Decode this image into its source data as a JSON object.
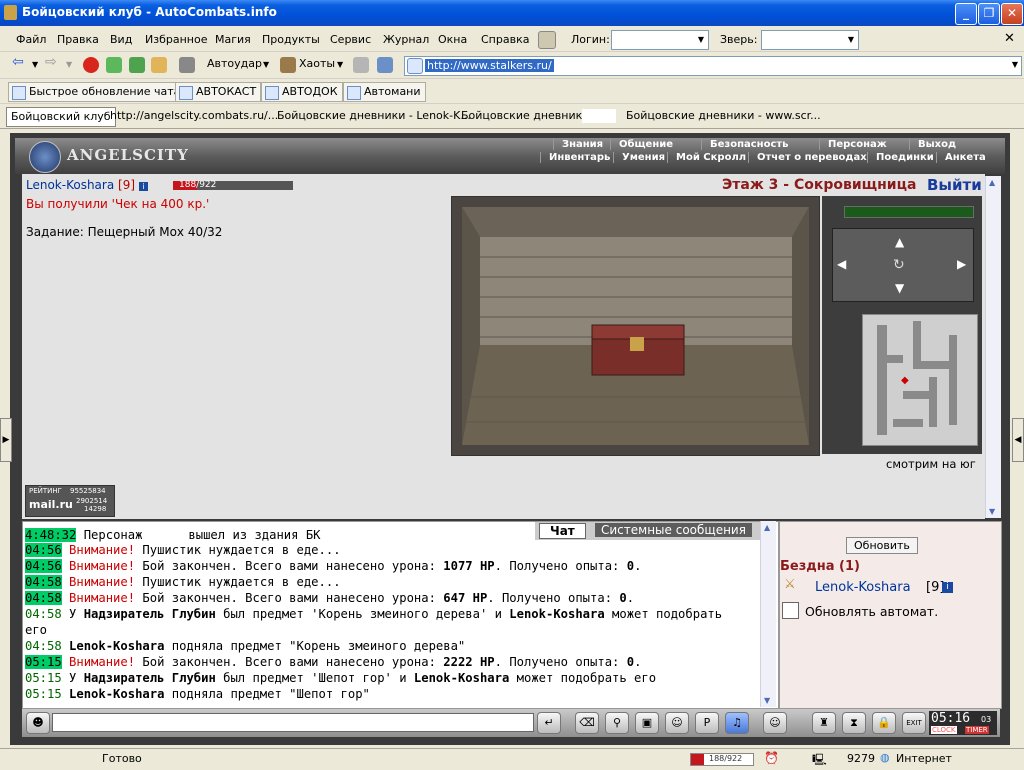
{
  "window": {
    "title": "Бойцовский клуб - AutoCombats.info"
  },
  "menu": {
    "items": [
      "Файл",
      "Правка",
      "Вид",
      "Избранное",
      "Магия",
      "Продукты",
      "Сервис",
      "Журнал",
      "Окна",
      "Справка"
    ],
    "login_label": "Логин:",
    "pet_label": "Зверь:"
  },
  "toolbar": {
    "autohit": "Автоудар",
    "chaos": "Хаоты",
    "url": "http://www.stalkers.ru/"
  },
  "links": [
    "Быстрое обновление чата",
    "АВТОКАСТ",
    "АВТОДОК",
    "Автомани"
  ],
  "tabs": [
    "Бойцовский клуб",
    "http://angelscity.combats.ru/...",
    "Бойцовские дневники - Lenok-K...",
    "Бойцовские дневники -",
    "Бойцовские дневники - www.scr..."
  ],
  "game_header": {
    "logo": "ANGELSCITY",
    "nav_top": [
      "Знания",
      "Общение",
      "Безопасность",
      "Персонаж",
      "Выход"
    ],
    "nav_bottom": [
      "Инвентарь",
      "Умения",
      "Мой Скролл",
      "Отчет о переводах",
      "Поединки",
      "Анкета"
    ]
  },
  "player": {
    "name": "Lenok-Koshara",
    "level": "[9]",
    "hp_current": 188,
    "hp_max": 922,
    "hp_text": "188/922"
  },
  "main": {
    "message": "Вы получили 'Чек на 400 кр.'",
    "task": "Задание: Пещерный Мох 40/32",
    "location": "Этаж 3 - Сокровищница",
    "exit": "Выйти",
    "facing": "смотрим на юг",
    "rating_label": "РЕЙТИНГ",
    "rating_value": "95525834",
    "counter1": "2902514",
    "counter2": "14298",
    "mailru": "mail.ru"
  },
  "chat": {
    "tabs": [
      "Чат",
      "Системные сообщения"
    ],
    "lines": [
      {
        "time": "4:48:32",
        "type": "plain",
        "text": "Персонаж",
        "text2": "вышел из здания БК"
      },
      {
        "time": "04:56",
        "type": "warn",
        "warn": "Внимание!",
        "text": "Пушистик нуждается в еде..."
      },
      {
        "time": "04:56",
        "type": "warn",
        "warn": "Внимание!",
        "text": "Бой закончен. Всего вами нанесено урона: ",
        "bold": "1077 HP",
        "text2": ". Получено опыта: ",
        "bold2": "0",
        "text3": "."
      },
      {
        "time": "04:58",
        "type": "warn",
        "warn": "Внимание!",
        "text": "Пушистик нуждается в еде..."
      },
      {
        "time": "04:58",
        "type": "warn",
        "warn": "Внимание!",
        "text": "Бой закончен. Всего вами нанесено урона: ",
        "bold": "647 HP",
        "text2": ". Получено опыта: ",
        "bold2": "0",
        "text3": "."
      },
      {
        "time": "04:58",
        "type": "drop",
        "prefix": "У ",
        "bold": "Надзиратель Глубин",
        "text": " был предмет 'Корень змеиного дерева' и ",
        "bold2": "Lenok-Koshara",
        "text2": " может подобрать"
      },
      {
        "time": "",
        "type": "cont",
        "text": "его"
      },
      {
        "time": "04:58",
        "type": "pick",
        "bold": "Lenok-Koshara",
        "text": " подняла предмет \"Корень змеиного дерева\""
      },
      {
        "time": "05:15",
        "type": "warn",
        "warn": "Внимание!",
        "text": "Бой закончен. Всего вами нанесено урона: ",
        "bold": "2222 HP",
        "text2": ". Получено опыта: ",
        "bold2": "0",
        "text3": "."
      },
      {
        "time": "05:15",
        "type": "drop",
        "prefix": "У ",
        "bold": "Надзиратель Глубин",
        "text": " был предмет 'Шепот гор' и ",
        "bold2": "Lenok-Koshara",
        "text2": " может подобрать его"
      },
      {
        "time": "05:15",
        "type": "pick",
        "bold": "Lenok-Koshara",
        "text": " подняла предмет \"Шепот гор\""
      }
    ]
  },
  "right_panel": {
    "refresh": "Обновить",
    "room": "Бездна (1)",
    "member": "Lenok-Koshara",
    "member_level": "[9]",
    "auto_refresh": "Обновлять автомат."
  },
  "clock": {
    "time": "05:16",
    "seconds": "03",
    "label1": "CLOCK",
    "label2": "TIMER",
    "exit": "EXIT"
  },
  "status": {
    "ready": "Готово",
    "hp": "188/922",
    "count": "9279",
    "zone": "Интернет"
  }
}
